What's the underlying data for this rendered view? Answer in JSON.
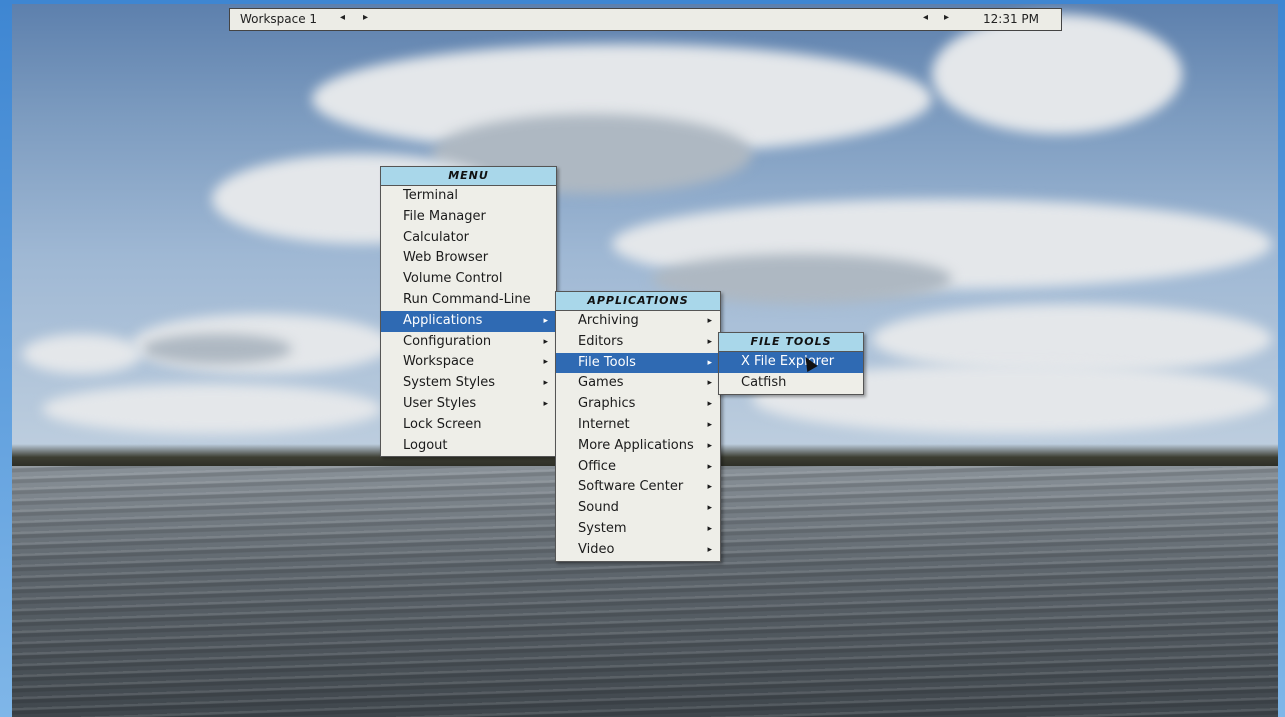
{
  "panel": {
    "workspace": "Workspace 1",
    "prev_arrow": "◂",
    "next_arrow": "▸",
    "prev_arrow2": "◂",
    "next_arrow2": "▸",
    "clock": "12:31 PM"
  },
  "menu": {
    "title": "MENU",
    "items": [
      {
        "label": "Terminal",
        "submenu": false
      },
      {
        "label": "File Manager",
        "submenu": false
      },
      {
        "label": "Calculator",
        "submenu": false
      },
      {
        "label": "Web Browser",
        "submenu": false
      },
      {
        "label": "Volume Control",
        "submenu": false
      },
      {
        "label": "Run Command-Line",
        "submenu": false
      },
      {
        "label": "Applications",
        "submenu": true,
        "selected": true
      },
      {
        "label": "Configuration",
        "submenu": true
      },
      {
        "label": "Workspace",
        "submenu": true
      },
      {
        "label": "System Styles",
        "submenu": true
      },
      {
        "label": "User Styles",
        "submenu": true
      },
      {
        "label": "Lock Screen",
        "submenu": false
      },
      {
        "label": "Logout",
        "submenu": false
      }
    ]
  },
  "applications": {
    "title": "APPLICATIONS",
    "items": [
      {
        "label": "Archiving",
        "submenu": true
      },
      {
        "label": "Editors",
        "submenu": true
      },
      {
        "label": "File Tools",
        "submenu": true,
        "selected": true
      },
      {
        "label": "Games",
        "submenu": true
      },
      {
        "label": "Graphics",
        "submenu": true
      },
      {
        "label": "Internet",
        "submenu": true
      },
      {
        "label": "More Applications",
        "submenu": true
      },
      {
        "label": "Office",
        "submenu": true
      },
      {
        "label": "Software Center",
        "submenu": true
      },
      {
        "label": "Sound",
        "submenu": true
      },
      {
        "label": "System",
        "submenu": true
      },
      {
        "label": "Video",
        "submenu": true
      }
    ]
  },
  "file_tools": {
    "title": "FILE TOOLS",
    "items": [
      {
        "label": "X File Explorer",
        "submenu": false,
        "selected": true
      },
      {
        "label": "Catfish",
        "submenu": false
      }
    ]
  },
  "chevron": "▸",
  "colors": {
    "menu_title_bg": "#a9d7ea",
    "selection_bg": "#2f6ab3",
    "menu_bg": "#eeeee8",
    "frame": "#3e86d2"
  }
}
